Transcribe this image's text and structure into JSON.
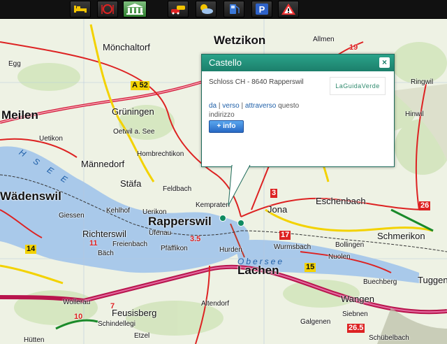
{
  "toolbar": {
    "buttons": [
      {
        "name": "hotel",
        "icon": "bed-icon"
      },
      {
        "name": "restaurant",
        "icon": "dining-icon"
      },
      {
        "name": "museum",
        "icon": "museum-icon",
        "active": true
      },
      {
        "name": "traffic",
        "icon": "cars-icon"
      },
      {
        "name": "weather",
        "icon": "weather-icon"
      },
      {
        "name": "fuel",
        "icon": "fuel-pump-icon"
      },
      {
        "name": "parking",
        "icon": "parking-icon"
      },
      {
        "name": "warning",
        "icon": "warning-icon"
      }
    ]
  },
  "map": {
    "places": {
      "rapperswil": "Rapperswil",
      "lachen": "Lachen",
      "wadenswil": "Wädenswil",
      "stafa": "Stäfa",
      "meilen": "Meilen",
      "jona": "Jona",
      "eschenbach": "Eschenbach",
      "schmerikon": "Schmerikon",
      "monchaltorf": "Mönchaltorf",
      "wetzikon": "Wetzikon",
      "gruningen": "Grüningen",
      "oetwil": "Oetwil a. See",
      "hombrechtikon": "Hombrechtikon",
      "mannedorf": "Männedorf",
      "richterswil": "Richterswil",
      "freienbach": "Freienbach",
      "pfaffikon": "Pfäffikon",
      "hurden": "Hurden",
      "altendorf": "Altendorf",
      "wangen": "Wangen",
      "tuggen": "Tuggen",
      "feusisberg": "Feusisberg",
      "wollerau": "Wollerau",
      "kempraten": "Kempraten",
      "giessen": "Giessen",
      "uetikon": "Uetikon",
      "egg": "Egg",
      "kehlhof": "Kehlhof",
      "uerikon": "Uerikon",
      "feldbach": "Feldbach",
      "ufenau": "Ufenau",
      "bach": "Bäch",
      "hutten": "Hütten",
      "schindellegi": "Schindellegi",
      "etzel": "Etzel",
      "galgenen": "Galgenen",
      "siebnen": "Siebnen",
      "schubelbach": "Schübelbach",
      "nuolen": "Nuolen",
      "wurmsbach": "Wurmsbach",
      "bollingen": "Bollingen",
      "buechberg": "Buechberg",
      "allmen": "Allmen",
      "ringwil": "Ringwil",
      "hinwil": "Hinwil"
    },
    "lake_labels": {
      "zurichsee": "H  S  E  E",
      "obersee": "Obersee"
    },
    "road_numbers": {
      "a52": "A 52",
      "n3": "3",
      "n17": "17",
      "n14": "14",
      "n15": "15",
      "n11": "11",
      "n26": "26",
      "n19": "19",
      "n7": "7",
      "n10": "10",
      "n35": "3.5",
      "n265": "26.5"
    }
  },
  "popup": {
    "title": "Castello",
    "close_label": "×",
    "address": "Schloss CH - 8640 Rapperswil",
    "logo_text": "LaGuidaVerde",
    "link_da": "da",
    "link_verso": "verso",
    "link_attraverso": "attraverso",
    "links_suffix": "questo indirizzo",
    "info_button": "+ info"
  }
}
